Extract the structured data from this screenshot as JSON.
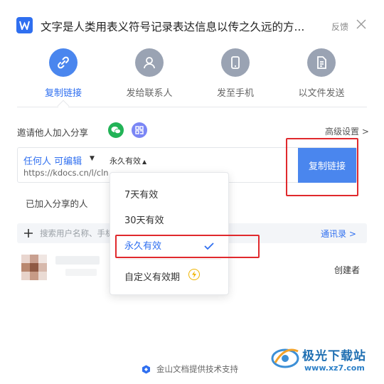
{
  "window": {
    "title": "文字是人类用表义符号记录表达信息以传之久远的方...",
    "feedback": "反馈"
  },
  "tabs": [
    {
      "label": "复制链接",
      "icon": "link-icon"
    },
    {
      "label": "发给联系人",
      "icon": "person-icon"
    },
    {
      "label": "发至手机",
      "icon": "phone-icon"
    },
    {
      "label": "以文件发送",
      "icon": "file-icon"
    }
  ],
  "invite": {
    "label": "邀请他人加入分享",
    "advanced": "高级设置 >"
  },
  "link": {
    "permission": "任何人 可编辑",
    "validity": "永久有效",
    "url": "https://kdocs.cn/l/clnLFoNZombT",
    "copy_button": "复制链接"
  },
  "joined_label": "已加入分享的人",
  "search": {
    "placeholder": "搜索用户名称、手机号",
    "contacts": "通讯录 >"
  },
  "member": {
    "role": "创建者"
  },
  "validity_menu": {
    "items": [
      "7天有效",
      "30天有效",
      "永久有效",
      "自定义有效期"
    ],
    "selected": "永久有效"
  },
  "footer": {
    "text": "金山文档提供技术支持"
  },
  "watermark": {
    "title": "极光下载站",
    "url": "www.xz7.com"
  },
  "colors": {
    "accent": "#2f6ff0",
    "copy_button": "#4a86ee",
    "highlight": "#e0292d",
    "tab_active": "#4a86ee",
    "tab_inactive": "#9aa3b3"
  }
}
